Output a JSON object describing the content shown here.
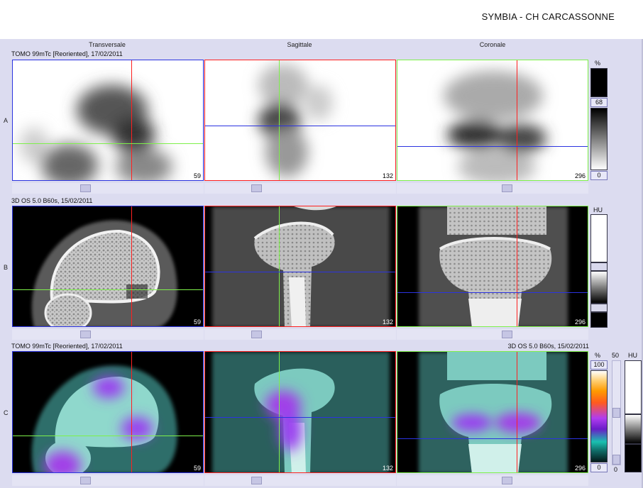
{
  "header": {
    "title": "SYMBIA - CH CARCASSONNE"
  },
  "columns": [
    "Transversale",
    "Sagittale",
    "Coronale"
  ],
  "rows": [
    {
      "label": "A",
      "series": "TOMO 99mTc [Reoriented], 17/02/2011",
      "series_right": ""
    },
    {
      "label": "B",
      "series": "3D  OS  5.0  B60s, 15/02/2011",
      "series_right": ""
    },
    {
      "label": "C",
      "series": "TOMO 99mTc [Reoriented], 17/02/2011",
      "series_right": "3D  OS  5.0  B60s, 15/02/2011"
    }
  ],
  "slices": [
    "59",
    "132",
    "296"
  ],
  "colorbars": {
    "a": {
      "unit": "%",
      "value": "68",
      "min": "0"
    },
    "b": {
      "unit": "HU"
    },
    "c": {
      "unit": "%",
      "max": "100",
      "min": "0",
      "aux_value": "50",
      "unit2": "HU",
      "aux_min": "0"
    }
  },
  "colors": {
    "red": "#ff2020",
    "green": "#7ef04a",
    "blue": "#2b33e0"
  }
}
